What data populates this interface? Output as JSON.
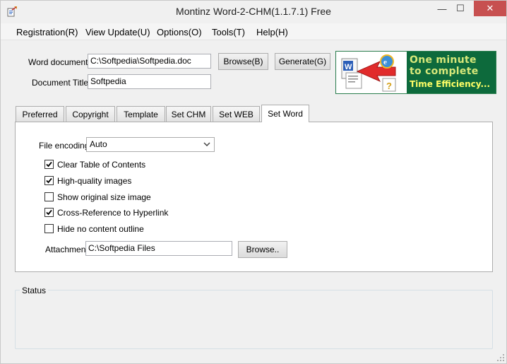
{
  "window": {
    "title": "Montinz Word-2-CHM(1.1.7.1) Free",
    "minimize_glyph": "—",
    "maximize_glyph": "☐",
    "close_glyph": "✕"
  },
  "menu": [
    {
      "label": "Registration(R)"
    },
    {
      "label": "View Update(U)"
    },
    {
      "label": "Options(O)"
    },
    {
      "label": "Tools(T)"
    },
    {
      "label": "Help(H)"
    }
  ],
  "form": {
    "word_document_label": "Word document:",
    "word_document_value": "C:\\Softpedia\\Softpedia.doc",
    "document_title_label": "Document Title:",
    "document_title_value": "Softpedia",
    "browse_label": "Browse(B)",
    "generate_label": "Generate(G)"
  },
  "banner": {
    "line1": "One minute",
    "line2": "to complete",
    "line3": "Time Efficiency..."
  },
  "tabs": [
    {
      "label": "Preferred"
    },
    {
      "label": "Copyright"
    },
    {
      "label": "Template"
    },
    {
      "label": "Set CHM"
    },
    {
      "label": "Set WEB"
    },
    {
      "label": "Set Word",
      "active": true
    }
  ],
  "set_word": {
    "encoding_label": "File encoding:",
    "encoding_value": "Auto",
    "options": [
      {
        "label": "Clear Table of Contents",
        "checked": true
      },
      {
        "label": "High-quality images",
        "checked": true
      },
      {
        "label": "Show original size image",
        "checked": false
      },
      {
        "label": "Cross-Reference to Hyperlink",
        "checked": true
      },
      {
        "label": "Hide no content outline",
        "checked": false
      }
    ],
    "attachment_label": "Attachment:",
    "attachment_value": "C:\\Softpedia Files",
    "attachment_browse_label": "Browse.."
  },
  "status": {
    "title": "Status"
  },
  "colors": {
    "close_button": "#c75050",
    "banner_bg": "#0d6a3c",
    "banner_text": "#d7e87a"
  }
}
